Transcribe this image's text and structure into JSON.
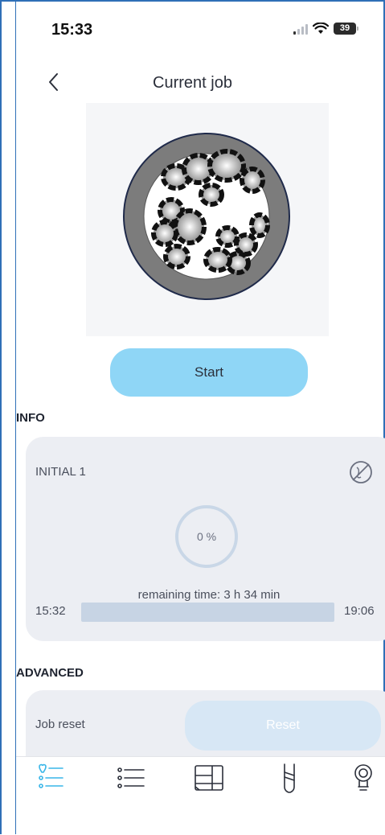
{
  "status_bar": {
    "time": "15:33",
    "battery": "39"
  },
  "header": {
    "title": "Current job",
    "back_icon": "chevron-left-icon"
  },
  "actions": {
    "start_label": "Start"
  },
  "info": {
    "section_title": "INFO",
    "job_name": "INITIAL 1",
    "progress_label": "0 %",
    "progress_fraction": 0,
    "remaining_time": "remaining time: 3 h 34 min",
    "start_time": "15:32",
    "end_time": "19:06"
  },
  "advanced": {
    "section_title": "ADVANCED",
    "job_reset_label": "Job reset",
    "reset_label": "Reset"
  },
  "tabs": [
    {
      "name": "jobs-tab",
      "icon": "tooth-list-icon",
      "active": true
    },
    {
      "name": "list-tab",
      "icon": "list-icon",
      "active": false
    },
    {
      "name": "material-tab",
      "icon": "material-block-icon",
      "active": false
    },
    {
      "name": "tools-tab",
      "icon": "milling-tool-icon",
      "active": false
    },
    {
      "name": "service-tab",
      "icon": "lightbulb-icon",
      "active": false
    }
  ],
  "colors": {
    "accent": "#8fd6f6",
    "active_tab": "#39b6e8",
    "card": "#eceef3"
  }
}
